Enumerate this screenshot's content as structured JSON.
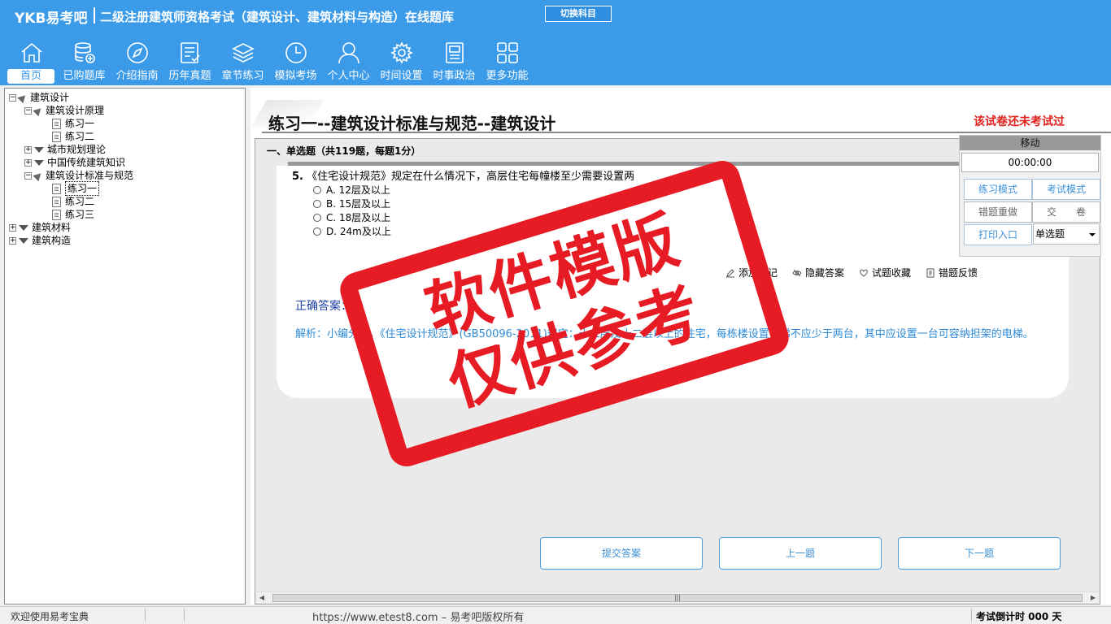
{
  "header": {
    "brand": "YKB易考吧",
    "title": "二级注册建筑师资格考试（建筑设计、建筑材料与构造）在线题库",
    "switch_label": "切换科目"
  },
  "nav": [
    {
      "label": "首页",
      "icon": "home-icon"
    },
    {
      "label": "已购题库",
      "icon": "database-icon"
    },
    {
      "label": "介绍指南",
      "icon": "compass-icon"
    },
    {
      "label": "历年真题",
      "icon": "checklist-icon"
    },
    {
      "label": "章节练习",
      "icon": "layers-icon"
    },
    {
      "label": "模拟考场",
      "icon": "clock-icon"
    },
    {
      "label": "个人中心",
      "icon": "user-icon"
    },
    {
      "label": "时间设置",
      "icon": "gear-icon"
    },
    {
      "label": "时事政治",
      "icon": "news-icon"
    },
    {
      "label": "更多功能",
      "icon": "grid-icon"
    }
  ],
  "tree": {
    "root": "建筑设计",
    "n1": "建筑设计原理",
    "n1a": "练习一",
    "n1b": "练习二",
    "n2": "城市规划理论",
    "n3": "中国传统建筑知识",
    "n4": "建筑设计标准与规范",
    "n4a": "练习一",
    "n4b": "练习二",
    "n4c": "练习三",
    "root2": "建筑材料",
    "root3": "建筑构造"
  },
  "paper": {
    "title": "练习一--建筑设计标准与规范--建筑设计",
    "status": "该试卷还未考试过",
    "section": "一、单选题（共119题，每题1分）"
  },
  "question": {
    "number": "5.",
    "text": "《住宅设计规范》规定在什么情况下，高层住宅每幢楼至少需要设置两",
    "options": [
      "A. 12层及以上",
      "B. 15层及以上",
      "C. 18层及以上",
      "D. 24m及以上"
    ]
  },
  "tools": {
    "note": "添加笔记",
    "hide": "隐藏答案",
    "fav": "试题收藏",
    "report": "错题反馈"
  },
  "answer": {
    "label": "正确答案：",
    "value": "A"
  },
  "analysis": "解析：小编分析，《住宅设计规范》(GB50096-2011)规定：十二层及十二层以上的住宅，每栋楼设置电梯不应少于两台，其中应设置一台可容纳担架的电梯。",
  "buttons": {
    "submit": "提交答案",
    "prev": "上一题",
    "next": "下一题"
  },
  "float": {
    "title": "移动",
    "timer": "00:00:00",
    "practice": "练习模式",
    "exam": "考试模式",
    "redo": "错题重做",
    "hand_in": "交　　卷",
    "print": "打印入口",
    "type": "单选题"
  },
  "status": {
    "welcome": "欢迎使用易考宝典",
    "site": "https://www.etest8.com – 易考吧版权所有",
    "countdown": "考试倒计时 000 天"
  },
  "watermark": {
    "line1": "软件模版",
    "line2": "仅供参考"
  },
  "colors": {
    "header": "#3c9be8",
    "stamp": "#e71b23",
    "status_red": "#e0201b"
  }
}
